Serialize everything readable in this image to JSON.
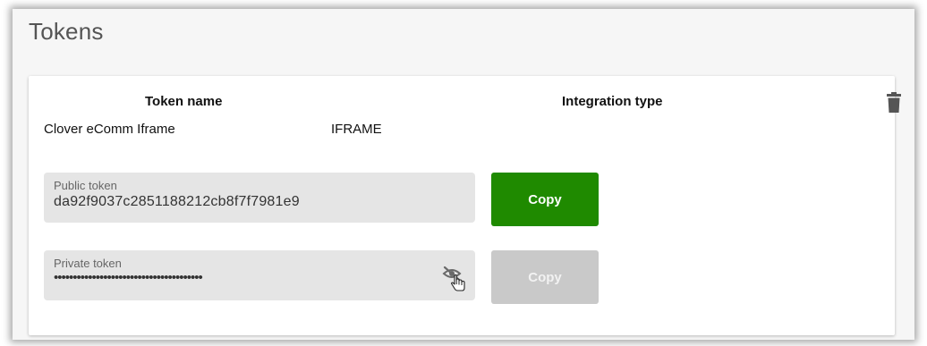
{
  "page": {
    "title": "Tokens"
  },
  "table": {
    "columns": [
      "Token name",
      "Integration type"
    ],
    "rows": [
      {
        "token_name": "Clover eComm Iframe",
        "integration_type": "IFRAME"
      }
    ],
    "delete_icon": "trash-icon"
  },
  "public_token": {
    "label": "Public token",
    "value": "da92f9037c2851188212cb8f7f7981e9",
    "copy_label": "Copy",
    "copy_enabled": true
  },
  "private_token": {
    "label": "Private token",
    "value": "•••••••••••••••••••••••••••••••••••••••",
    "visibility_icon": "eye-off-icon",
    "cursor_icon": "hand-pointer-icon",
    "copy_label": "Copy",
    "copy_enabled": false
  },
  "colors": {
    "primary_button": "#1f8a00",
    "disabled_button": "#c9c9c9",
    "field_background": "#e5e5e5"
  }
}
